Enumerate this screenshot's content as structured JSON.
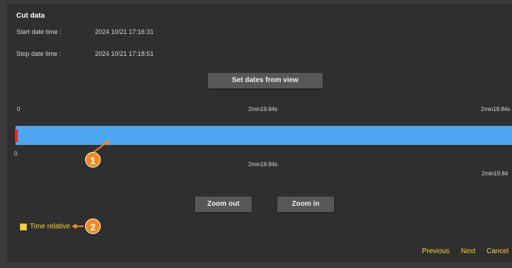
{
  "dialog": {
    "title": "Cut data",
    "start_label": "Start date time :",
    "start_value": "2024 10/21 17:16:31",
    "stop_label": "Stop date time :",
    "stop_value": "2024 10/21 17:18:51",
    "set_dates_button": "Set dates from view"
  },
  "timeline": {
    "top_ticks": [
      "0",
      "2min19.84s",
      "2min19.84s"
    ],
    "bottom_ticks": [
      "0",
      "2min19.84s",
      "2min19.84"
    ],
    "bar_color": "#4ea6f0",
    "handle_color": "#e8281e"
  },
  "zoom": {
    "zoom_out": "Zoom out",
    "zoom_in": "Zoom in"
  },
  "options": {
    "time_relative_label": "Time relative",
    "time_relative_checked": true
  },
  "footer": {
    "previous": "Previous",
    "next": "Next",
    "cancel": "Cancel"
  },
  "callouts": {
    "badge_1": "1",
    "badge_2": "2",
    "color": "#f08a22"
  },
  "colors": {
    "accent_yellow": "#f4d03f",
    "background": "#2f2f2f"
  }
}
